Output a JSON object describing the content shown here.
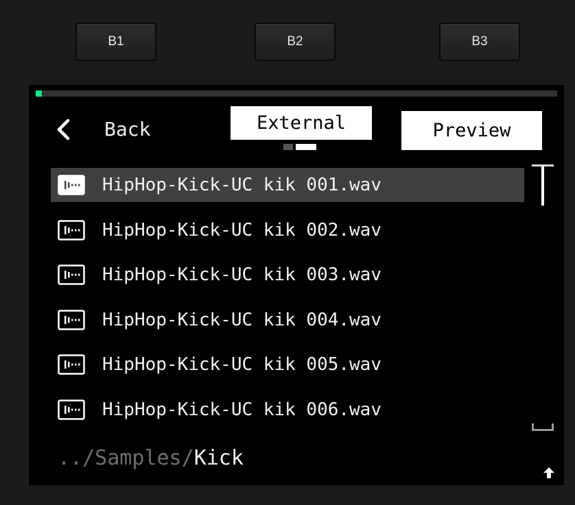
{
  "hardware_buttons": [
    {
      "label": "B1"
    },
    {
      "label": "B2"
    },
    {
      "label": "B3"
    }
  ],
  "screen": {
    "progress": 0.012,
    "progress_color": "#19e38a",
    "back": {
      "icon": "chevron-left-icon",
      "label": "Back"
    },
    "tab": {
      "label": "External"
    },
    "pager": {
      "count": 2,
      "active": 2
    },
    "preview_button": {
      "label": "Preview"
    },
    "files": [
      {
        "icon": "audio-file-icon",
        "name": "HipHop-Kick-UC kik 001.wav",
        "selected": true
      },
      {
        "icon": "audio-file-icon",
        "name": "HipHop-Kick-UC kik 002.wav",
        "selected": false
      },
      {
        "icon": "audio-file-icon",
        "name": "HipHop-Kick-UC kik 003.wav",
        "selected": false
      },
      {
        "icon": "audio-file-icon",
        "name": "HipHop-Kick-UC kik 004.wav",
        "selected": false
      },
      {
        "icon": "audio-file-icon",
        "name": "HipHop-Kick-UC kik 005.wav",
        "selected": false
      },
      {
        "icon": "audio-file-icon",
        "name": "HipHop-Kick-UC kik 006.wav",
        "selected": false
      }
    ],
    "path": {
      "parent": "../Samples/",
      "current": "Kick"
    },
    "up_icon": "up-arrow-icon"
  }
}
